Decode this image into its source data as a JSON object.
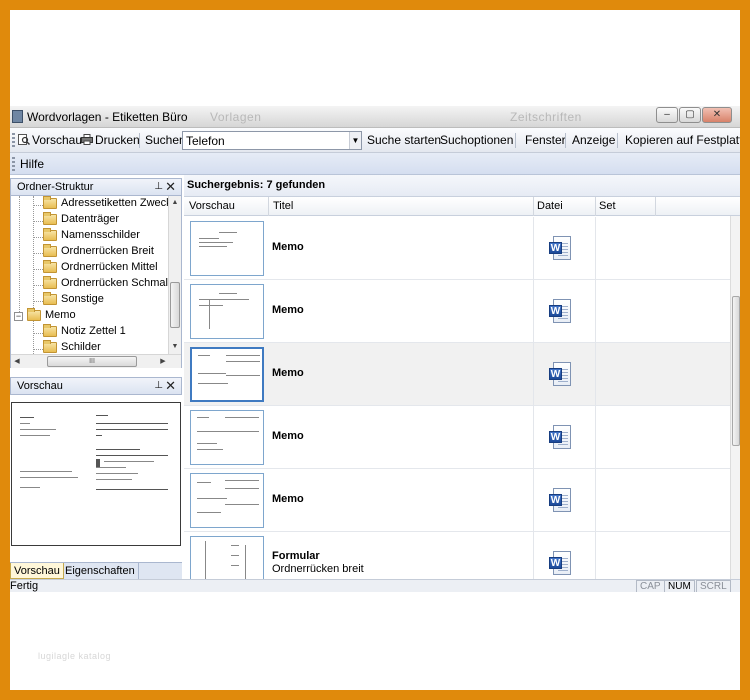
{
  "window": {
    "title": "Wordvorlagen - Etiketten Büro",
    "ghost_labels": [
      "Vorlagen",
      "Zeitschriften"
    ],
    "minimize": "‒",
    "maximize": "▢",
    "close": "✕"
  },
  "toolbar": {
    "preview_label": "Vorschau",
    "print_label": "Drucken",
    "search_label": "Suchen",
    "search_value": "Telefon",
    "start_search_label": "Suche starten",
    "search_options_label": "Suchoptionen",
    "window_label": "Fenster",
    "view_label": "Anzeige",
    "copy_label": "Kopieren auf Festplatte"
  },
  "menubar": {
    "help_label": "Hilfe"
  },
  "folder_panel": {
    "title": "Ordner-Struktur",
    "pin": "⊥",
    "close": "✕",
    "items": [
      {
        "label": "Adressetiketten Zweck"
      },
      {
        "label": "Datenträger"
      },
      {
        "label": "Namensschilder"
      },
      {
        "label": "Ordnerrücken Breit"
      },
      {
        "label": "Ordnerrücken Mittel"
      },
      {
        "label": "Ordnerrücken Schmal"
      },
      {
        "label": "Sonstige"
      },
      {
        "label": "Memo"
      },
      {
        "label": "Notiz Zettel 1"
      },
      {
        "label": "Schilder"
      }
    ],
    "hscroll_thumb": "III"
  },
  "preview_panel": {
    "title": "Vorschau",
    "pin": "⊥",
    "close": "✕"
  },
  "bottom_tabs": [
    "Vorschau",
    "Eigenschaften"
  ],
  "results": {
    "header": "Suchergebnis: 7 gefunden",
    "columns": [
      "Vorschau",
      "Titel",
      "Datei",
      "Set"
    ],
    "rows": [
      {
        "title": "Memo",
        "subtitle": ""
      },
      {
        "title": "Memo",
        "subtitle": ""
      },
      {
        "title": "Memo",
        "subtitle": ""
      },
      {
        "title": "Memo",
        "subtitle": ""
      },
      {
        "title": "Memo",
        "subtitle": ""
      },
      {
        "title": "Formular",
        "subtitle": "Ordnerrücken breit"
      }
    ],
    "file_icon": "W"
  },
  "statusbar": {
    "text": "Fertig",
    "indicators": [
      "CAP",
      "NUM",
      "SCRL"
    ]
  },
  "watermark": "lugilagle katalog"
}
